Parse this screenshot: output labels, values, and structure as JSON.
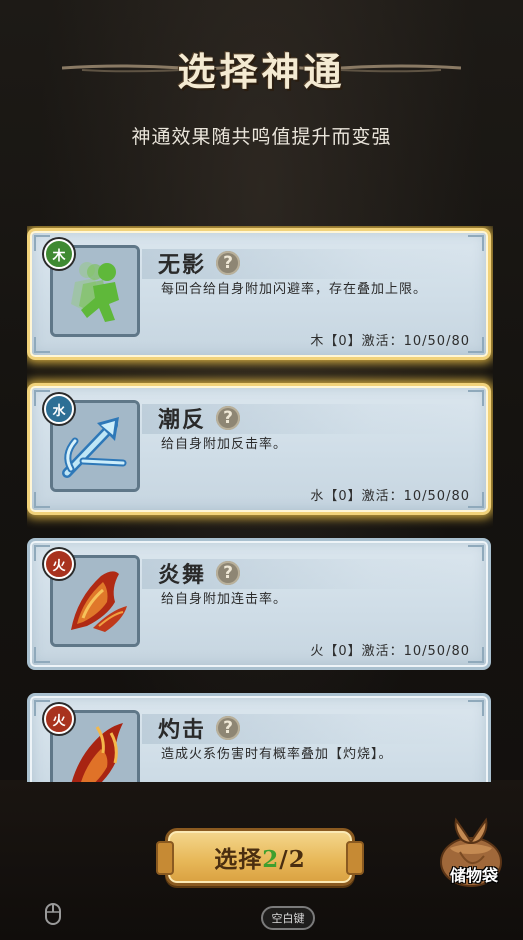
{
  "header": {
    "title": "选择神通",
    "subtitle": "神通效果随共鸣值提升而变强"
  },
  "colors": {
    "wood": "#3f8a32",
    "water": "#2d6f95",
    "fire": "#a8321e",
    "selected_glow": "#f2c446",
    "card_bg": "#d5e2eb",
    "count_green": "#3f9f2e"
  },
  "skills": [
    {
      "name": "无影",
      "element": "木",
      "icon": "running-figure-icon",
      "description": "每回合给自身附加闪避率，存在叠加上限。",
      "activation": "木【0】激活：10/50/80",
      "selected": true
    },
    {
      "name": "潮反",
      "element": "水",
      "icon": "water-arrow-icon",
      "description": "给自身附加反击率。",
      "activation": "水【0】激活：10/50/80",
      "selected": true
    },
    {
      "name": "炎舞",
      "element": "火",
      "icon": "fire-feather-icon",
      "description": "给自身附加连击率。",
      "activation": "火【0】激活：10/50/80",
      "selected": false
    },
    {
      "name": "灼击",
      "element": "火",
      "icon": "fire-slash-icon",
      "description": "造成火系伤害时有概率叠加【灼烧】。",
      "activation": "",
      "selected": false
    }
  ],
  "help_symbol": "?",
  "select_button": {
    "label": "选择",
    "selected_count": "2",
    "separator": "/",
    "max_count": "2"
  },
  "bag": {
    "label": "储物袋",
    "icon": "cloth-bag-icon"
  },
  "hint": {
    "mouse_icon": "mouse-icon",
    "space_label": "空白键"
  }
}
